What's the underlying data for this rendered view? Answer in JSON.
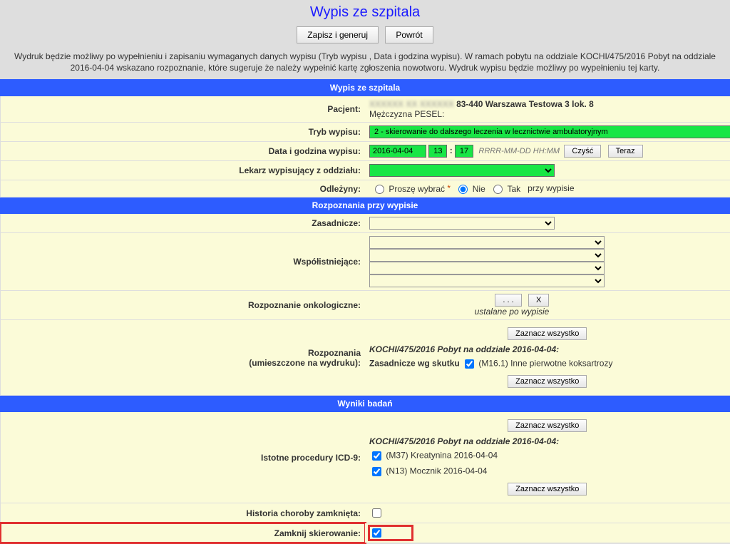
{
  "title": "Wypis ze szpitala",
  "top_buttons": {
    "save": "Zapisz i generuj",
    "back": "Powrót"
  },
  "intro": "Wydruk będzie możliwy po wypełnieniu i zapisaniu wymaganych danych wypisu (Tryb wypisu , Data i godzina wypisu). W ramach pobytu na oddziale KOCHI/475/2016 Pobyt na oddziale 2016-04-04 wskazano rozpoznanie, które sugeruje że należy wypełnić kartę zgłoszenia nowotworu. Wydruk wypisu będzie możliwy po wypełnieniu tej karty.",
  "sections": {
    "wypis_header": "Wypis ze szpitala",
    "rozpoznania_header": "Rozpoznania przy wypisie",
    "wyniki_header": "Wyniki badań"
  },
  "labels": {
    "pacjent": "Pacjent:",
    "tryb": "Tryb wypisu:",
    "data": "Data i godzina wypisu:",
    "lekarz": "Lekarz wypisujący z oddziału:",
    "odlezyny": "Odleżyny:",
    "zasadnicze": "Zasadnicze:",
    "wspolistniejace": "Współistniejące:",
    "onkol": "Rozpoznanie onkologiczne:",
    "rozp_wydruk_l1": "Rozpoznania",
    "rozp_wydruk_l2": "(umieszczone na wydruku):",
    "icd9": "Istotne procedury ICD-9:",
    "historia": "Historia choroby zamknięta:",
    "zamknij": "Zamknij skierowanie:"
  },
  "patient": {
    "address": "83-440 Warszawa Testowa 3 lok. 8",
    "extra": "Mężczyzna PESEL:"
  },
  "tryb_value": "2 - skierowanie do dalszego leczenia w lecznictwie ambulatoryjnym",
  "date": {
    "ymd": "2016-04-04",
    "hh": "13",
    "mm": "17",
    "hint": "RRRR-MM-DD HH:MM",
    "clear": "Czyść",
    "now": "Teraz"
  },
  "odlezyny": {
    "choose": "Proszę wybrać",
    "no": "Nie",
    "yes": "Tak",
    "suffix": "przy wypisie"
  },
  "onkol": {
    "dots": ". . .",
    "x": "X",
    "note": "ustalane po wypisie"
  },
  "buttons": {
    "select_all": "Zaznacz wszystko"
  },
  "stay": {
    "header": "KOCHI/475/2016 Pobyt na oddziale 2016-04-04:",
    "zasadnicze_wg": "Zasadnicze wg skutku",
    "zasadnicze_code": "(M16.1) Inne pierwotne koksartrozy"
  },
  "icd9_items": [
    "(M37) Kreatynina 2016-04-04",
    "(N13) Mocznik 2016-04-04"
  ]
}
